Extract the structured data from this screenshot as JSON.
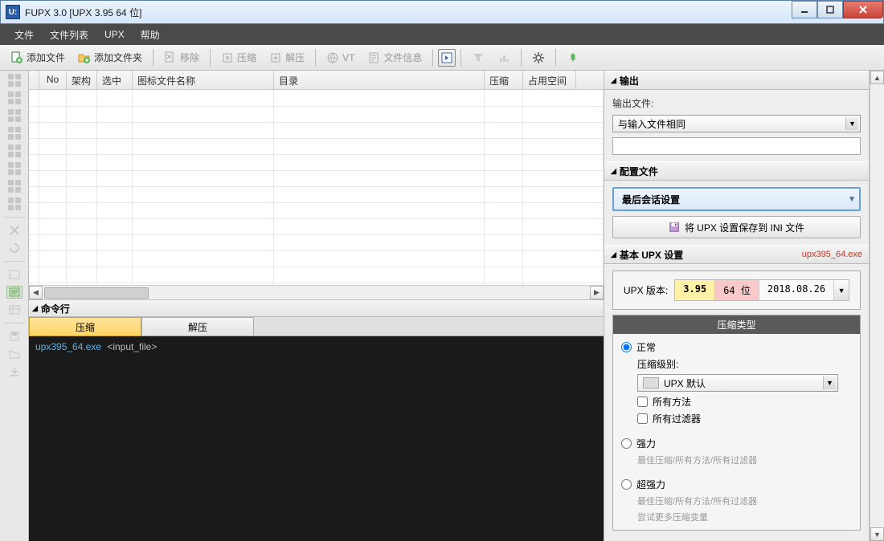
{
  "title": "FUPX 3.0   [UPX 3.95 64 位]",
  "app_icon_text": "U:",
  "menu": {
    "file": "文件",
    "filelist": "文件列表",
    "upx": "UPX",
    "help": "帮助"
  },
  "toolbar": {
    "add_file": "添加文件",
    "add_folder": "添加文件夹",
    "remove": "移除",
    "compress": "压缩",
    "decompress": "解压",
    "vt": "VT",
    "fileinfo": "文件信息"
  },
  "columns": {
    "no": "No",
    "arch": "架构",
    "sel": "选中",
    "iconfile": "图标文件名称",
    "dir": "目录",
    "comp": "压缩",
    "size": "占用空间"
  },
  "cmdline": {
    "header": "命令行",
    "tab_compress": "压缩",
    "tab_decompress": "解压",
    "exe": "upx395_64.exe",
    "arg": "<input_file>"
  },
  "right": {
    "output_hdr": "输出",
    "output_file_lbl": "输出文件:",
    "output_file_val": "与输入文件相同",
    "profile_hdr": "配置文件",
    "profile_val": "最后会话设置",
    "save_ini": "将 UPX 设置保存到 INI 文件",
    "basic_hdr": "基本 UPX 设置",
    "basic_exe": "upx395_64.exe",
    "upx_ver_lbl": "UPX 版本:",
    "upx_ver_num": "3.95",
    "upx_ver_bits": "64 位",
    "upx_ver_date": "2018.08.26",
    "compress_type_hdr": "压缩类型",
    "opt_normal": "正常",
    "level_lbl": "压缩级别:",
    "level_val": "UPX 默认",
    "all_methods": "所有方法",
    "all_filters": "所有过滤器",
    "opt_strong": "强力",
    "strong_desc": "最佳压缩/所有方法/所有过滤器",
    "opt_super": "超强力",
    "super_desc1": "最佳压缩/所有方法/所有过滤器",
    "super_desc2": "尝试更多压缩变量"
  }
}
